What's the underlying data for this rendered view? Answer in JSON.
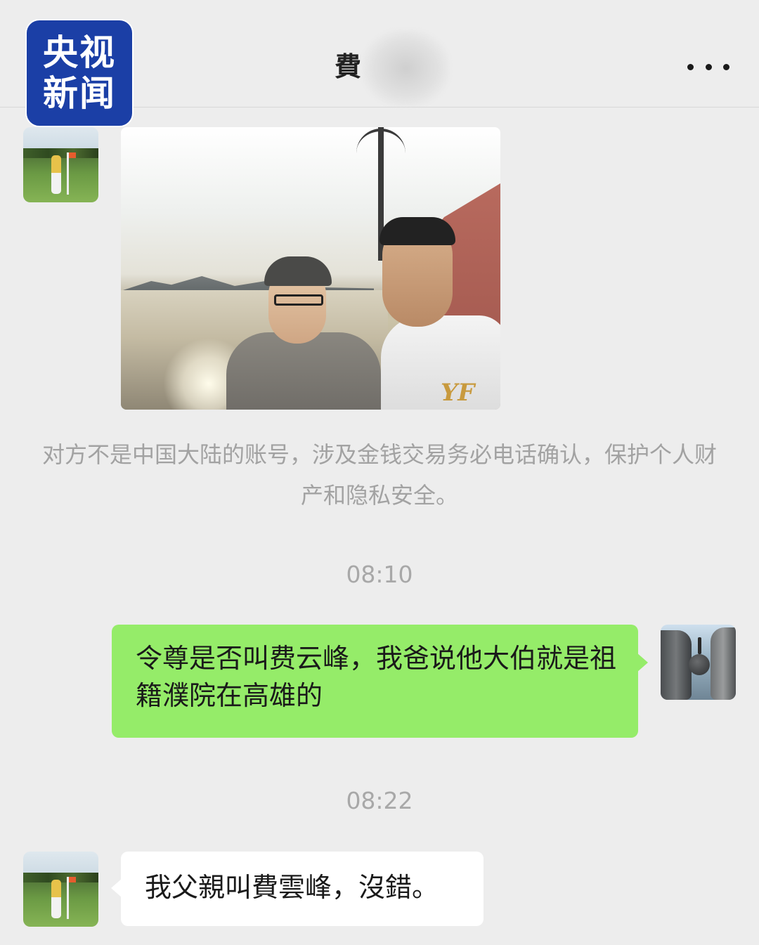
{
  "logo": {
    "line1": "央视",
    "line2": "新闻"
  },
  "header": {
    "title": "費",
    "more_icon": "more-dots-icon"
  },
  "messages": [
    {
      "type": "image",
      "sender": "contact",
      "avatar": "golf-avatar",
      "logo_text": "YF"
    },
    {
      "type": "notice",
      "text": "对方不是中国大陆的账号，涉及金钱交易务必电话确认，保护个人财产和隐私安全。"
    },
    {
      "type": "time",
      "text": "08:10"
    },
    {
      "type": "text",
      "sender": "self",
      "avatar": "rock-avatar",
      "text": "令尊是否叫费云峰，我爸说他大伯就是祖籍濮院在高雄的"
    },
    {
      "type": "time",
      "text": "08:22"
    },
    {
      "type": "text",
      "sender": "contact",
      "avatar": "golf-avatar",
      "text": "我父親叫費雲峰，沒錯。"
    }
  ],
  "colors": {
    "background": "#ededed",
    "self_bubble": "#95ec69",
    "contact_bubble": "#ffffff",
    "logo_bg": "#1b3fa6"
  }
}
